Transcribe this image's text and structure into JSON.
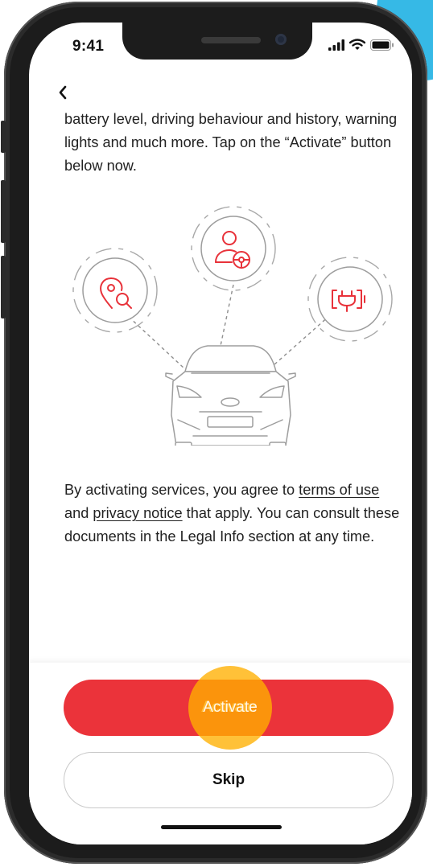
{
  "status_bar": {
    "time": "9:41"
  },
  "content": {
    "intro_text": "battery level, driving behaviour and history, warning lights and much more. Tap on the “Activate” button below now.",
    "consent": {
      "before": "By activating services, you agree to ",
      "terms_link": "terms of use",
      "between": " and ",
      "privacy_link": "privacy notice",
      "after": " that apply. You can consult these documents in the Legal Info section at any time."
    }
  },
  "actions": {
    "activate_label": "Activate",
    "skip_label": "Skip"
  },
  "icons": {
    "back": "chevron-left-icon",
    "features": [
      "location-search-icon",
      "driver-profile-icon",
      "ev-charging-icon"
    ],
    "vehicle": "car-front-icon"
  },
  "colors": {
    "accent_red": "#eb333a",
    "icon_red": "#e8323a",
    "tap_highlight": "#ffb000",
    "device_frame": "#1c1c1c",
    "corner_accent": "#36b9e6"
  }
}
